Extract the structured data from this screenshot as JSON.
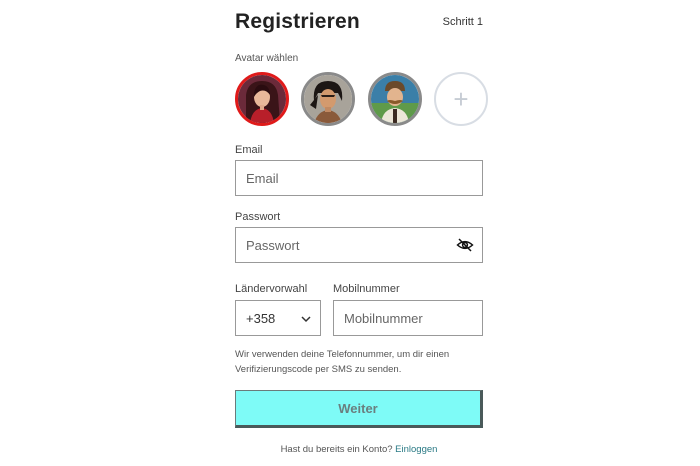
{
  "header": {
    "title": "Registrieren",
    "step": "Schritt 1"
  },
  "avatar": {
    "label": "Avatar wählen",
    "add_symbol": "+"
  },
  "email": {
    "label": "Email",
    "placeholder": "Email"
  },
  "password": {
    "label": "Passwort",
    "placeholder": "Passwort"
  },
  "country": {
    "label": "Ländervorwahl",
    "value": "+358"
  },
  "mobile": {
    "label": "Mobilnummer",
    "placeholder": "Mobilnummer"
  },
  "info": {
    "text": "Wir verwenden deine Telefonnummer, um dir einen Verifizierungscode per SMS zu senden."
  },
  "submit": {
    "label": "Weiter"
  },
  "footer": {
    "question": "Hast du bereits ein Konto?",
    "link": "Einloggen"
  },
  "colors": {
    "selected_border": "#e01a1a",
    "button_bg": "#7efbf7",
    "link": "#2a7a85"
  }
}
